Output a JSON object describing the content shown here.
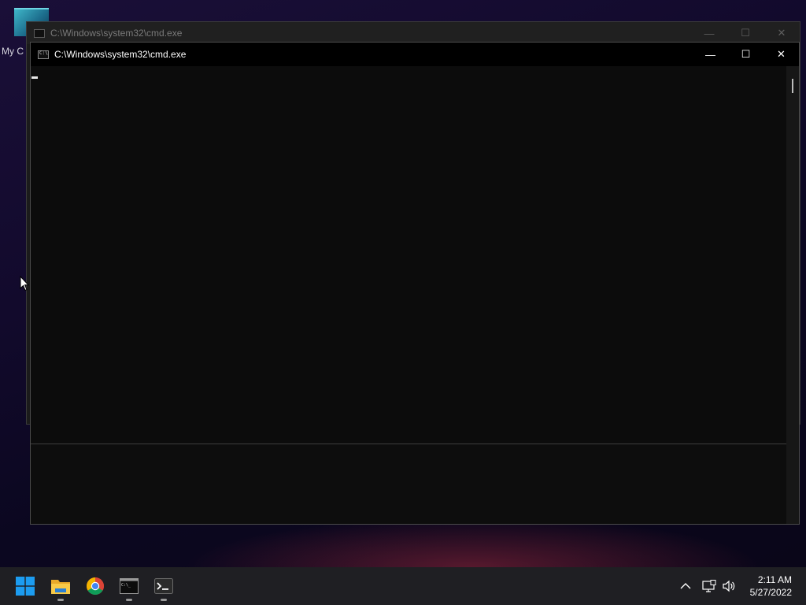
{
  "desktop": {
    "icon_label": "My C"
  },
  "background_window": {
    "title": "C:\\Windows\\system32\\cmd.exe",
    "minimize_glyph": "—",
    "maximize_glyph": "☐",
    "close_glyph": "✕"
  },
  "front_window": {
    "title": "C:\\Windows\\system32\\cmd.exe",
    "icon_text": "C:\\",
    "minimize_glyph": "—",
    "maximize_glyph": "☐",
    "close_glyph": "✕"
  },
  "taskbar": {
    "items": [
      {
        "name": "start-button",
        "icon": "windows-logo-icon"
      },
      {
        "name": "file-explorer",
        "icon": "folder-icon",
        "running": true
      },
      {
        "name": "chrome",
        "icon": "chrome-icon",
        "running": false
      },
      {
        "name": "cmd",
        "icon": "cmd-icon",
        "running": true
      },
      {
        "name": "terminal",
        "icon": "terminal-icon",
        "running": true
      }
    ],
    "tray": {
      "chevron": "^",
      "time": "2:11 AM",
      "date": "5/27/2022"
    }
  },
  "colors": {
    "accent": "#0078d4",
    "console_bg": "#0c0c0c",
    "taskbar_bg": "#1f1f23"
  }
}
